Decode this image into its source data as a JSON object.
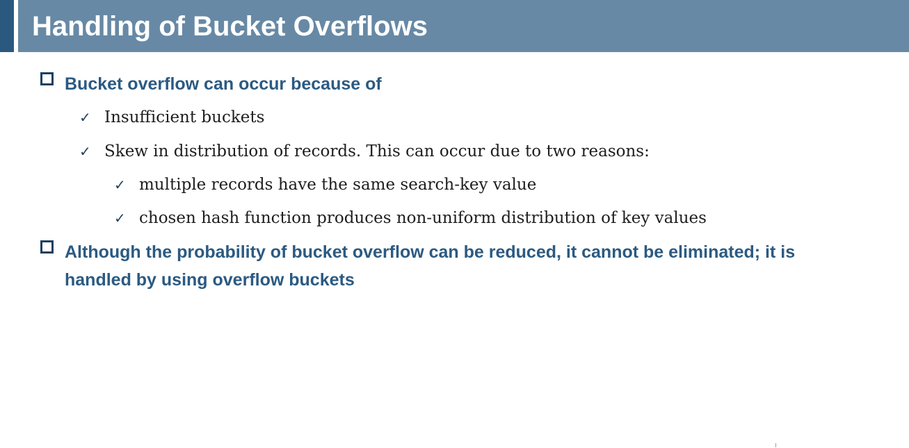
{
  "slide": {
    "title": "Handling of Bucket Overflows",
    "bullets": [
      {
        "icon": "square-bullet-icon",
        "text": "Bucket overflow can occur because of",
        "sub": [
          {
            "icon": "checkmark-icon",
            "text": "Insufficient buckets"
          },
          {
            "icon": "checkmark-icon",
            "text": "Skew in distribution of records.  This can occur due to two reasons:",
            "sub": [
              {
                "icon": "checkmark-icon",
                "text": "multiple records have the same search-key value"
              },
              {
                "icon": "checkmark-icon",
                "text": "chosen hash function produces non-uniform distribution of key values"
              }
            ]
          }
        ]
      },
      {
        "icon": "square-bullet-icon",
        "text": "Although the probability of bucket overflow can be reduced, it cannot be eliminated; it is handled by using overflow buckets"
      }
    ],
    "colors": {
      "title_bar": "#6789a5",
      "title_accent": "#2b587f",
      "heading_text": "#2b5a82",
      "body_text": "#1e1e1e"
    }
  }
}
